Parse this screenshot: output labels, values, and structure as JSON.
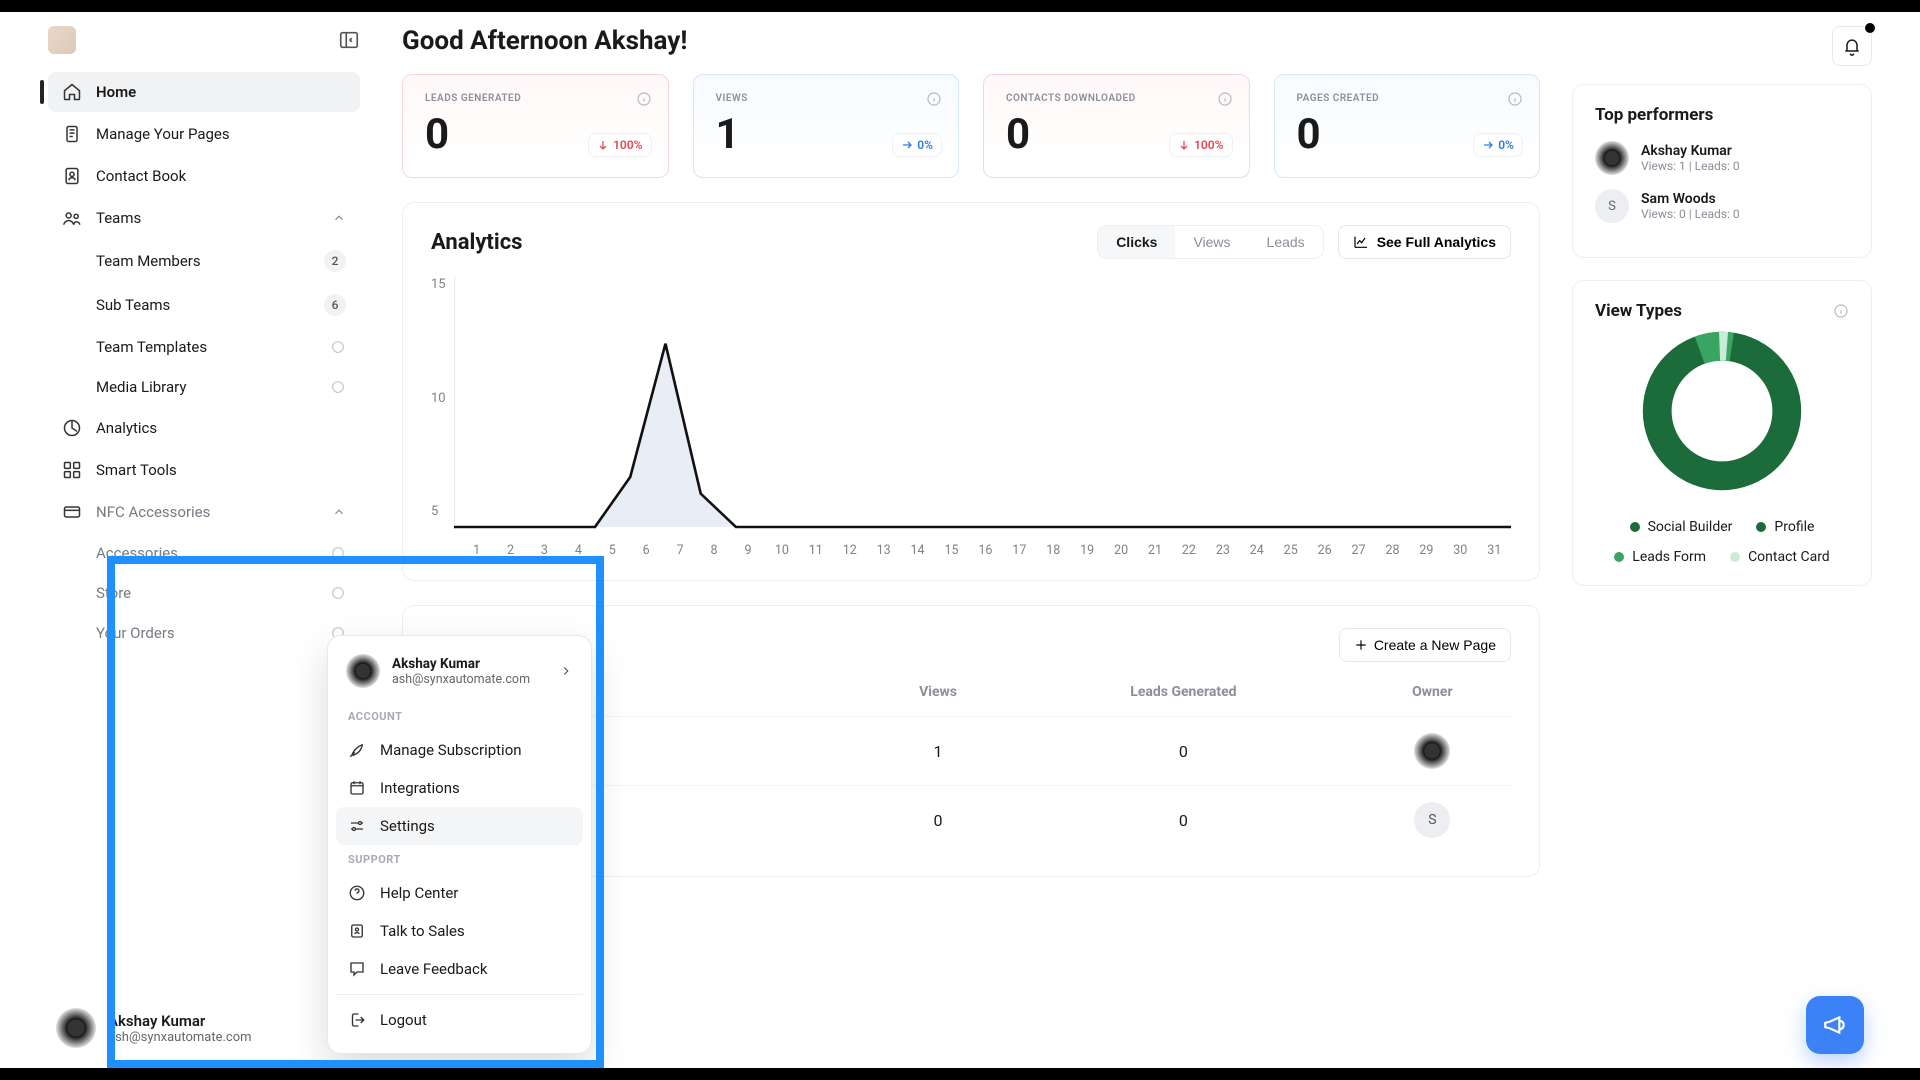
{
  "greeting": "Good Afternoon Akshay!",
  "sidebar": {
    "items": [
      {
        "label": "Home"
      },
      {
        "label": "Manage Your Pages"
      },
      {
        "label": "Contact Book"
      },
      {
        "label": "Teams"
      },
      {
        "label": "Team Members",
        "badge": "2"
      },
      {
        "label": "Sub Teams",
        "badge": "6"
      },
      {
        "label": "Team Templates"
      },
      {
        "label": "Media Library"
      },
      {
        "label": "Analytics"
      },
      {
        "label": "Smart Tools"
      },
      {
        "label": "NFC Accessories"
      },
      {
        "label": "Accessories"
      },
      {
        "label": "Store"
      },
      {
        "label": "Your Orders"
      }
    ]
  },
  "user": {
    "name": "Akshay Kumar",
    "email": "ash@synxautomate.com"
  },
  "kpis": [
    {
      "label": "LEADS GENERATED",
      "value": "0",
      "delta": "100%",
      "trend": "down"
    },
    {
      "label": "VIEWS",
      "value": "1",
      "delta": "0%",
      "trend": "flat"
    },
    {
      "label": "CONTACTS DOWNLOADED",
      "value": "0",
      "delta": "100%",
      "trend": "down"
    },
    {
      "label": "PAGES CREATED",
      "value": "0",
      "delta": "0%",
      "trend": "flat"
    }
  ],
  "analytics": {
    "title": "Analytics",
    "tabs": [
      "Clicks",
      "Views",
      "Leads"
    ],
    "see_full": "See Full Analytics"
  },
  "chart_data": {
    "type": "line",
    "ylabel": "",
    "ylim": [
      0,
      15
    ],
    "yticks": [
      15,
      10,
      5
    ],
    "x": [
      1,
      2,
      3,
      4,
      5,
      6,
      7,
      8,
      9,
      10,
      11,
      12,
      13,
      14,
      15,
      16,
      17,
      18,
      19,
      20,
      21,
      22,
      23,
      24,
      25,
      26,
      27,
      28,
      29,
      30,
      31
    ],
    "values": [
      0,
      0,
      0,
      0,
      0,
      3,
      11,
      2,
      0,
      0,
      0,
      0,
      0,
      0,
      0,
      0,
      0,
      0,
      0,
      0,
      0,
      0,
      0,
      0,
      0,
      0,
      0,
      0,
      0,
      0,
      0
    ]
  },
  "pages": {
    "title_hidden": "",
    "create_label": "Create a New Page",
    "columns": [
      "Views",
      "Leads Generated",
      "Owner"
    ],
    "rows": [
      {
        "views": "1",
        "leads": "0",
        "owner": "img"
      },
      {
        "views": "0",
        "leads": "0",
        "owner": "S"
      }
    ]
  },
  "top_performers": {
    "title": "Top performers",
    "list": [
      {
        "name": "Akshay Kumar",
        "sub": "Views: 1   |   Leads: 0",
        "av": "img"
      },
      {
        "name": "Sam Woods",
        "sub": "Views: 0   |   Leads: 0",
        "av": "S"
      }
    ]
  },
  "view_types": {
    "title": "View Types",
    "legend": [
      {
        "label": "Social Builder",
        "color": "#1c6b3a"
      },
      {
        "label": "Profile",
        "color": "#1c6b3a"
      },
      {
        "label": "Leads Form",
        "color": "#3aa462"
      },
      {
        "label": "Contact Card",
        "color": "#c9ecd6"
      }
    ]
  },
  "popup": {
    "name": "Akshay Kumar",
    "email": "ash@synxautomate.com",
    "sec_account": "ACCOUNT",
    "sec_support": "SUPPORT",
    "items": {
      "sub": "Manage Subscription",
      "int": "Integrations",
      "set": "Settings",
      "help": "Help Center",
      "sales": "Talk to Sales",
      "fb": "Leave Feedback",
      "logout": "Logout"
    }
  }
}
